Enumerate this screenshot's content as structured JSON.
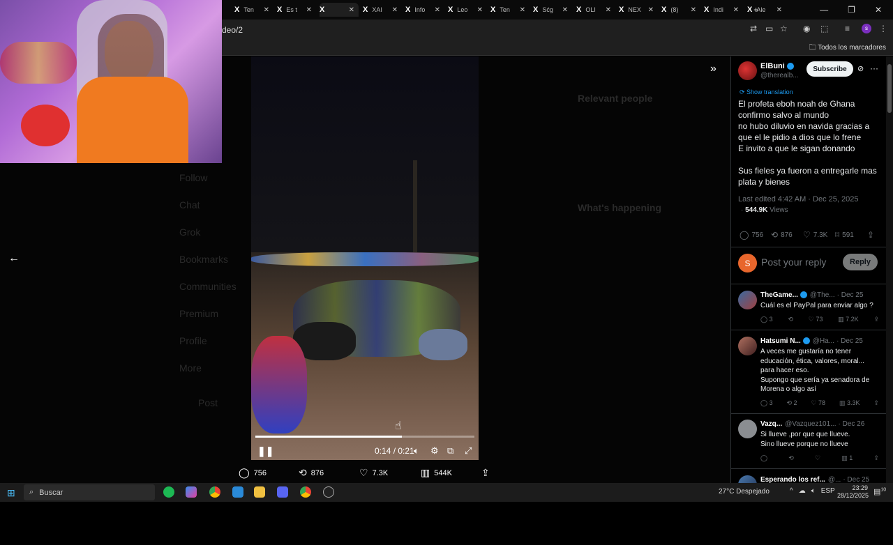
{
  "browser": {
    "tabs": [
      "Ten",
      "Es t",
      "",
      "XAI",
      "Info",
      "Leo",
      "Ten",
      "Sćg",
      "OLI",
      "NEX",
      "(8)",
      "Indi",
      "Ale"
    ],
    "address": "deo/2",
    "bookmarks_label": "Todos los marcadores"
  },
  "ghost_sidebar": [
    "Follow",
    "Chat",
    "Grok",
    "Bookmarks",
    "Communities",
    "Premium",
    "Profile",
    "More",
    "Post"
  ],
  "ghost_right": [
    "Relevant people",
    "What's happening"
  ],
  "video": {
    "time": "0:14 / 0:21",
    "progress": 0.67
  },
  "actions": {
    "replies": "756",
    "reposts": "876",
    "likes": "7.3K",
    "views": "544K"
  },
  "tweet": {
    "author_name": "ElBuni",
    "author_handle": "@therealb...",
    "subscribe_label": "Subscribe",
    "show_translation": "Show translation",
    "lines": [
      "El profeta eboh noah de Ghana",
      "confirmo salvo al mundo",
      "no hubo diluvio en navida gracias a",
      "que el le pidio a dios que lo frene",
      "E invito a que le sigan donando",
      "",
      "Sus fieles ya fueron a entregarle mas",
      "plata y bienes"
    ],
    "edited": "Last edited 4:42 AM · Dec 25, 2025",
    "views_count": "544.9K",
    "views_label": "Views",
    "stats": {
      "replies": "756",
      "reposts": "876",
      "likes": "7.3K",
      "bookmarks": "591"
    }
  },
  "reply_box": {
    "avatar_letter": "S",
    "placeholder": "Post your reply",
    "button": "Reply"
  },
  "comments": [
    {
      "name": "TheGame...",
      "handle": "@The...",
      "date": "· Dec 25",
      "text": "Cuál es el PayPal para enviar algo ?",
      "replies": "3",
      "reposts": "",
      "likes": "73",
      "views": "7.2K"
    },
    {
      "name": "Hatsumi N...",
      "handle": "@Ha...",
      "date": "· Dec 25",
      "text": "A veces me gustaría no tener educación, ética, valores, moral... para hacer eso.\nSupongo que sería ya senadora de Morena o algo así",
      "replies": "3",
      "reposts": "2",
      "likes": "78",
      "views": "3.3K"
    },
    {
      "name": "Vazq...",
      "handle": "@Vazquez101...",
      "date": "· Dec 26",
      "text": "Si llueve ,por que que llueve.\nSino llueve porque no llueve",
      "replies": "",
      "reposts": "",
      "likes": "",
      "views": "1"
    },
    {
      "name": "Esperando los ref...",
      "handle": "@...",
      "date": "· Dec 25",
      "text": "",
      "replies": "",
      "reposts": "",
      "likes": "",
      "views": ""
    }
  ],
  "taskbar": {
    "search_label": "Buscar",
    "weather": "27°C  Despejado",
    "lang": "ESP",
    "time": "23:29",
    "date": "28/12/2025",
    "notif_count": "10"
  },
  "colors": {
    "accent": "#1d9bf0",
    "background": "#000000",
    "reply_avatar": "#e8662c"
  },
  "icons": [
    "x-logo",
    "back-arrow-icon",
    "expand-icon",
    "reply-icon",
    "repost-icon",
    "like-icon",
    "views-icon",
    "share-icon",
    "bookmark-icon",
    "search-icon",
    "windows-icon"
  ]
}
